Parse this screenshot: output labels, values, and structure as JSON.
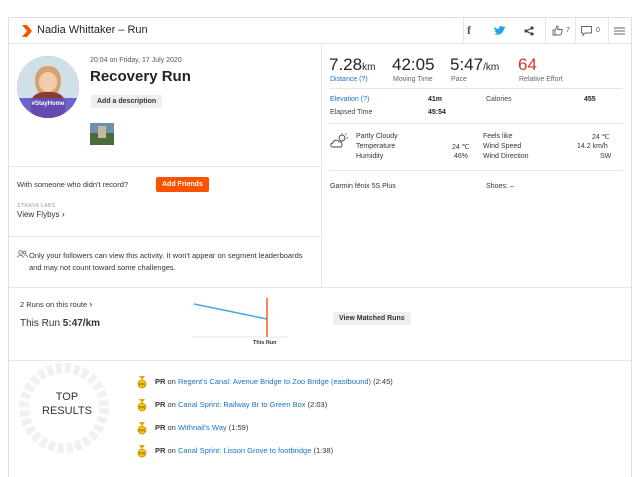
{
  "header": {
    "title": "Nadia Whittaker – Run",
    "kudos_count": "7",
    "comment_count": "0"
  },
  "athlete": {
    "avatar_tag": "#StayHome",
    "datetime": "20:04 on Friday, 17 July 2020",
    "activity_name": "Recovery Run",
    "add_description": "Add a description"
  },
  "stats": {
    "distance_value": "7.28",
    "distance_unit": "km",
    "distance_label": "Distance (?)",
    "moving_time_value": "42:05",
    "moving_time_label": "Moving Time",
    "pace_value": "5:47",
    "pace_unit": "/km",
    "pace_label": "Pace",
    "effort_value": "64",
    "effort_label": "Relative Effort"
  },
  "details": {
    "elevation_label": "Elevation (?)",
    "elevation_value": "41m",
    "calories_label": "Calories",
    "calories_value": "455",
    "elapsed_label": "Elapsed Time",
    "elapsed_value": "45:54"
  },
  "weather": {
    "condition": "Partly Cloudy",
    "temperature_label": "Temperature",
    "temperature_value": "24 ℃",
    "humidity_label": "Humidity",
    "humidity_value": "46%",
    "feels_like_label": "Feels like",
    "feels_like_value": "24 ℃",
    "wind_speed_label": "Wind Speed",
    "wind_speed_value": "14.2 km/h",
    "wind_dir_label": "Wind Direction",
    "wind_dir_value": "SW"
  },
  "gear": {
    "device": "Garmin fēnix 5S Plus",
    "shoes": "Shoes: –"
  },
  "social": {
    "record_prompt": "With someone who didn't record?",
    "add_friends": "Add Friends",
    "labs_label": "STRAVA LABS",
    "flybys": "View Flybys",
    "privacy_note": "Only your followers can view this activity. It won't appear on segment leaderboards and may not count toward some challenges."
  },
  "route": {
    "runs_on_route": "2 Runs on this route",
    "this_run_label": "This Run",
    "this_run_pace": "5:47/km",
    "chart_marker_label": "This Run",
    "view_matched": "View Matched Runs"
  },
  "top_results": {
    "title_line1": "TOP",
    "title_line2": "RESULTS",
    "items": [
      {
        "pr": "PR",
        "on": "on",
        "segment": "Regent's Canal: Avenue Bridge to Zoo Bridge (eastbound)",
        "time": "(2:45)"
      },
      {
        "pr": "PR",
        "on": "on",
        "segment": "Canal Sprint: Railway Br to Green Box",
        "time": "(2:03)"
      },
      {
        "pr": "PR",
        "on": "on",
        "segment": "Withnail's Way",
        "time": "(1:59)"
      },
      {
        "pr": "PR",
        "on": "on",
        "segment": "Canal Sprint: Lisson Grove to footbridge",
        "time": "(1:38)"
      }
    ]
  },
  "colors": {
    "brand": "#fc5200",
    "link": "#1a73c9",
    "effort": "#e0312d"
  }
}
